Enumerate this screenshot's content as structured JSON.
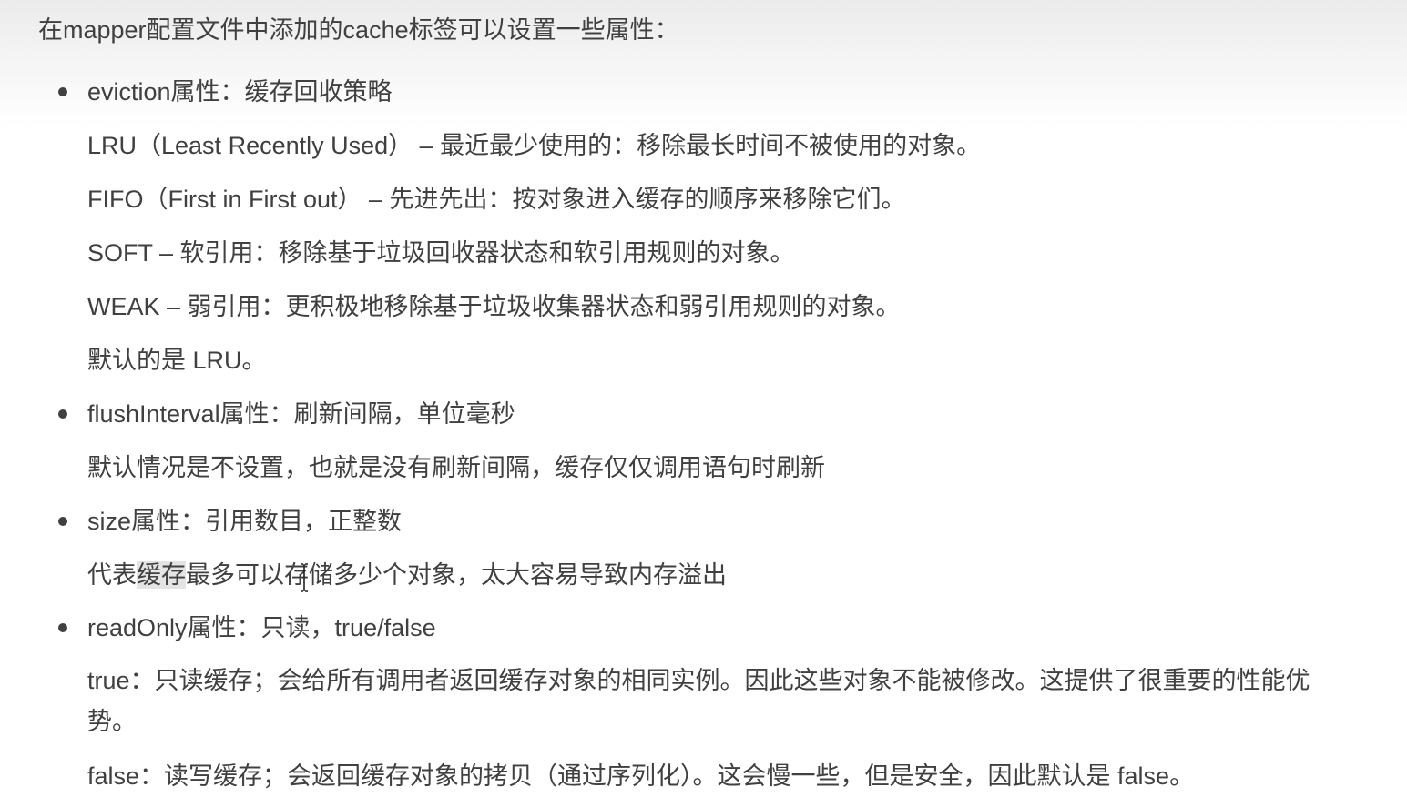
{
  "intro": "在mapper配置文件中添加的cache标签可以设置一些属性：",
  "eviction": {
    "title": "eviction属性：缓存回收策略",
    "lru": "LRU（Least Recently Used） – 最近最少使用的：移除最长时间不被使用的对象。",
    "fifo": "FIFO（First in First out） – 先进先出：按对象进入缓存的顺序来移除它们。",
    "soft": "SOFT – 软引用：移除基于垃圾回收器状态和软引用规则的对象。",
    "weak": "WEAK – 弱引用：更积极地移除基于垃圾收集器状态和弱引用规则的对象。",
    "default": "默认的是 LRU。"
  },
  "flush": {
    "title": "flushInterval属性：刷新间隔，单位毫秒",
    "desc": "默认情况是不设置，也就是没有刷新间隔，缓存仅仅调用语句时刷新"
  },
  "size": {
    "title": "size属性：引用数目，正整数",
    "desc_before": "代表",
    "desc_highlight": "缓存",
    "desc_after": "最多可以存储多少个对象，太大容易导致内存溢出"
  },
  "readonly": {
    "title": "readOnly属性：只读，true/false",
    "true_desc": "true：只读缓存；会给所有调用者返回缓存对象的相同实例。因此这些对象不能被修改。这提供了很重要的性能优势。",
    "false_desc": "false：读写缓存；会返回缓存对象的拷贝（通过序列化）。这会慢一些，但是安全，因此默认是 false。"
  }
}
